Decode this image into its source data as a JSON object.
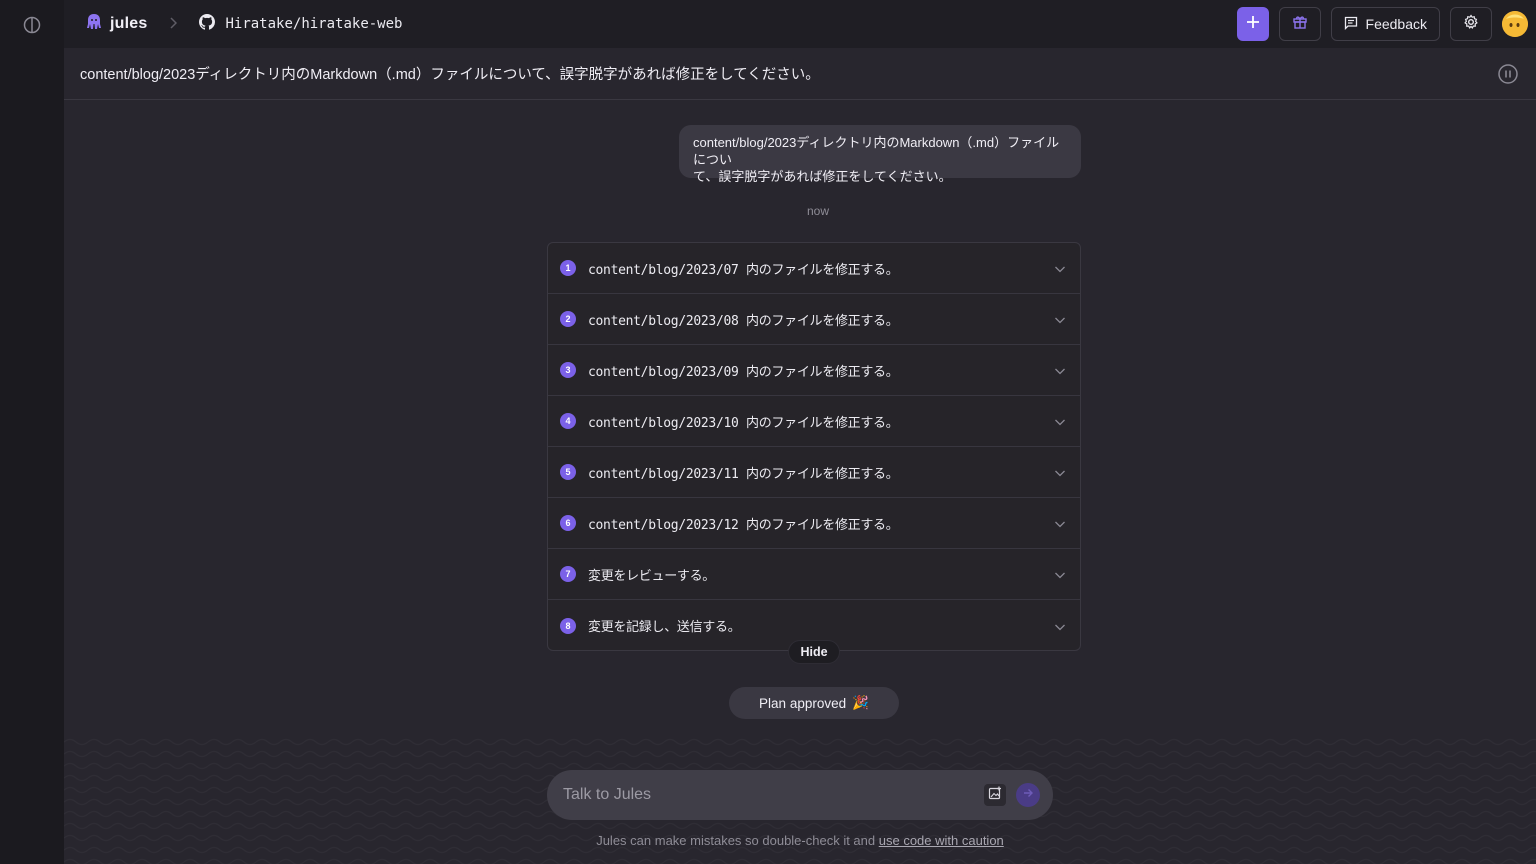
{
  "app": {
    "name": "jules",
    "repo": "Hiratake/hiratake-web"
  },
  "topbar": {
    "feedback_label": "Feedback"
  },
  "task": {
    "title": "content/blog/2023ディレクトリ内のMarkdown（.md）ファイルについて、誤字脱字があれば修正をしてください。"
  },
  "chat": {
    "user_message_line1": "content/blog/2023ディレクトリ内のMarkdown（.md）ファイルについ",
    "user_message_line2": "て、誤字脱字があれば修正をしてください。",
    "timestamp": "now",
    "plan_steps": [
      {
        "num": "1",
        "text": "content/blog/2023/07 内のファイルを修正する。"
      },
      {
        "num": "2",
        "text": "content/blog/2023/08 内のファイルを修正する。"
      },
      {
        "num": "3",
        "text": "content/blog/2023/09 内のファイルを修正する。"
      },
      {
        "num": "4",
        "text": "content/blog/2023/10 内のファイルを修正する。"
      },
      {
        "num": "5",
        "text": "content/blog/2023/11 内のファイルを修正する。"
      },
      {
        "num": "6",
        "text": "content/blog/2023/12 内のファイルを修正する。"
      },
      {
        "num": "7",
        "text": "変更をレビューする。"
      },
      {
        "num": "8",
        "text": "変更を記録し、送信する。"
      }
    ],
    "hide_label": "Hide",
    "plan_approved_label": "Plan approved",
    "plan_approved_emoji": "🎉"
  },
  "composer": {
    "placeholder": "Talk to Jules",
    "disclaimer_text": "Jules can make mistakes so double-check it and",
    "disclaimer_link": "use code with caution"
  },
  "colors": {
    "accent": "#7b61e8",
    "background": "#28262e",
    "topbar": "#1f1e24",
    "rail": "#1b1a1f"
  }
}
